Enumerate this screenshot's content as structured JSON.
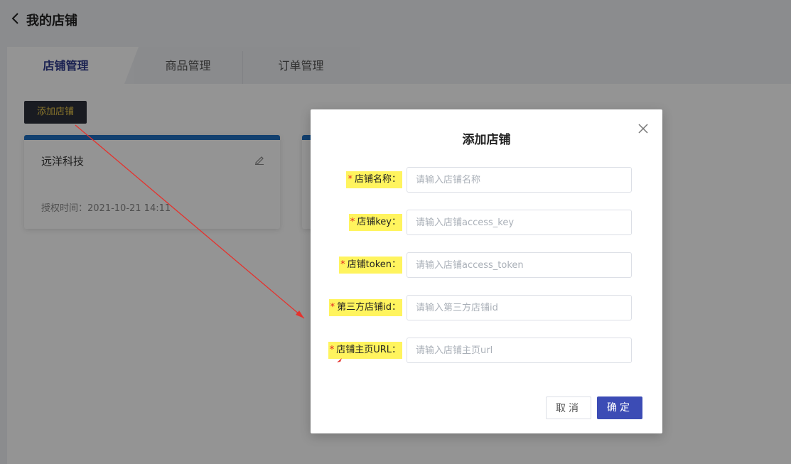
{
  "header": {
    "title": "我的店铺"
  },
  "tabs": [
    {
      "label": "店铺管理",
      "active": true
    },
    {
      "label": "商品管理",
      "active": false
    },
    {
      "label": "订单管理",
      "active": false
    }
  ],
  "toolbar": {
    "add_store_label": "添加店铺"
  },
  "cards": [
    {
      "name": "远洋科技",
      "auth_time": "授权时间：2021-10-21 14:11"
    }
  ],
  "modal": {
    "title": "添加店铺",
    "fields": [
      {
        "label": "店铺名称：",
        "required": true,
        "placeholder": "请输入店铺名称",
        "value": ""
      },
      {
        "label": "店铺key：",
        "required": true,
        "placeholder": "请输入店铺access_key",
        "value": ""
      },
      {
        "label": "店铺token：",
        "required": true,
        "placeholder": "请输入店铺access_token",
        "value": ""
      },
      {
        "label": "第三方店铺id：",
        "required": true,
        "placeholder": "请输入第三方店铺id",
        "value": ""
      },
      {
        "label": "店铺主页URL：",
        "required": true,
        "placeholder": "请输入店铺主页url",
        "value": ""
      }
    ],
    "cancel_label": "取消",
    "ok_label": "确定"
  },
  "icons": {
    "back": "chevron-left-icon",
    "edit": "pencil-icon",
    "close": "close-icon"
  },
  "colors": {
    "accent": "#3c4cb5",
    "card_bar": "#1f6fc0",
    "highlight": "#fff45e",
    "required": "#e02424"
  }
}
